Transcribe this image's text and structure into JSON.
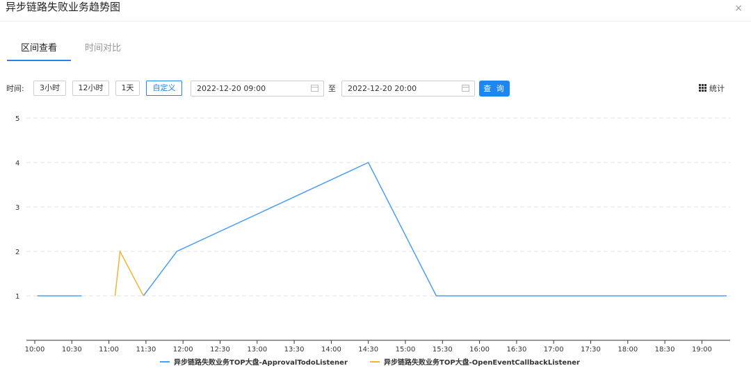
{
  "header": {
    "title": "异步链路失败业务趋势图",
    "close": "×"
  },
  "tabs": [
    {
      "label": "区间查看",
      "active": true
    },
    {
      "label": "时间对比",
      "active": false
    }
  ],
  "toolbar": {
    "time_label": "时间:",
    "ranges": [
      {
        "label": "3小时",
        "active": false
      },
      {
        "label": "12小时",
        "active": false
      },
      {
        "label": "1天",
        "active": false
      },
      {
        "label": "自定义",
        "active": true
      }
    ],
    "start": "2022-12-20 09:00",
    "to_label": "至",
    "end": "2022-12-20 20:00",
    "query_label": "查 询",
    "stats_label": "统计"
  },
  "colors": {
    "accent": "#1f86f0",
    "series1": "#4a9ff0",
    "series2": "#f5b335"
  },
  "chart_data": {
    "type": "line",
    "x_ticks": [
      "10:00",
      "10:30",
      "11:00",
      "11:30",
      "12:00",
      "12:30",
      "13:00",
      "13:30",
      "14:00",
      "14:30",
      "15:00",
      "15:30",
      "16:00",
      "16:30",
      "17:00",
      "17:30",
      "18:00",
      "18:30",
      "19:00"
    ],
    "y_ticks": [
      1,
      2,
      3,
      4,
      5
    ],
    "ylim": [
      0,
      5
    ],
    "grid": true,
    "legend": "bottom",
    "series": [
      {
        "name": "异步链路失败业务TOP大盘-ApprovalTodoListener",
        "color": "#4a9ff0",
        "segments": [
          [
            [
              "10:02",
              1
            ],
            [
              "10:38",
              1
            ]
          ],
          [
            [
              "11:28",
              1
            ],
            [
              "11:55",
              2
            ],
            [
              "14:30",
              4
            ],
            [
              "15:25",
              1
            ],
            [
              "19:20",
              1
            ]
          ]
        ]
      },
      {
        "name": "异步链路失败业务TOP大盘-OpenEventCallbackListener",
        "color": "#f5b335",
        "segments": [
          [
            [
              "11:05",
              1
            ],
            [
              "11:09",
              2
            ],
            [
              "11:28",
              1
            ]
          ]
        ]
      }
    ]
  }
}
